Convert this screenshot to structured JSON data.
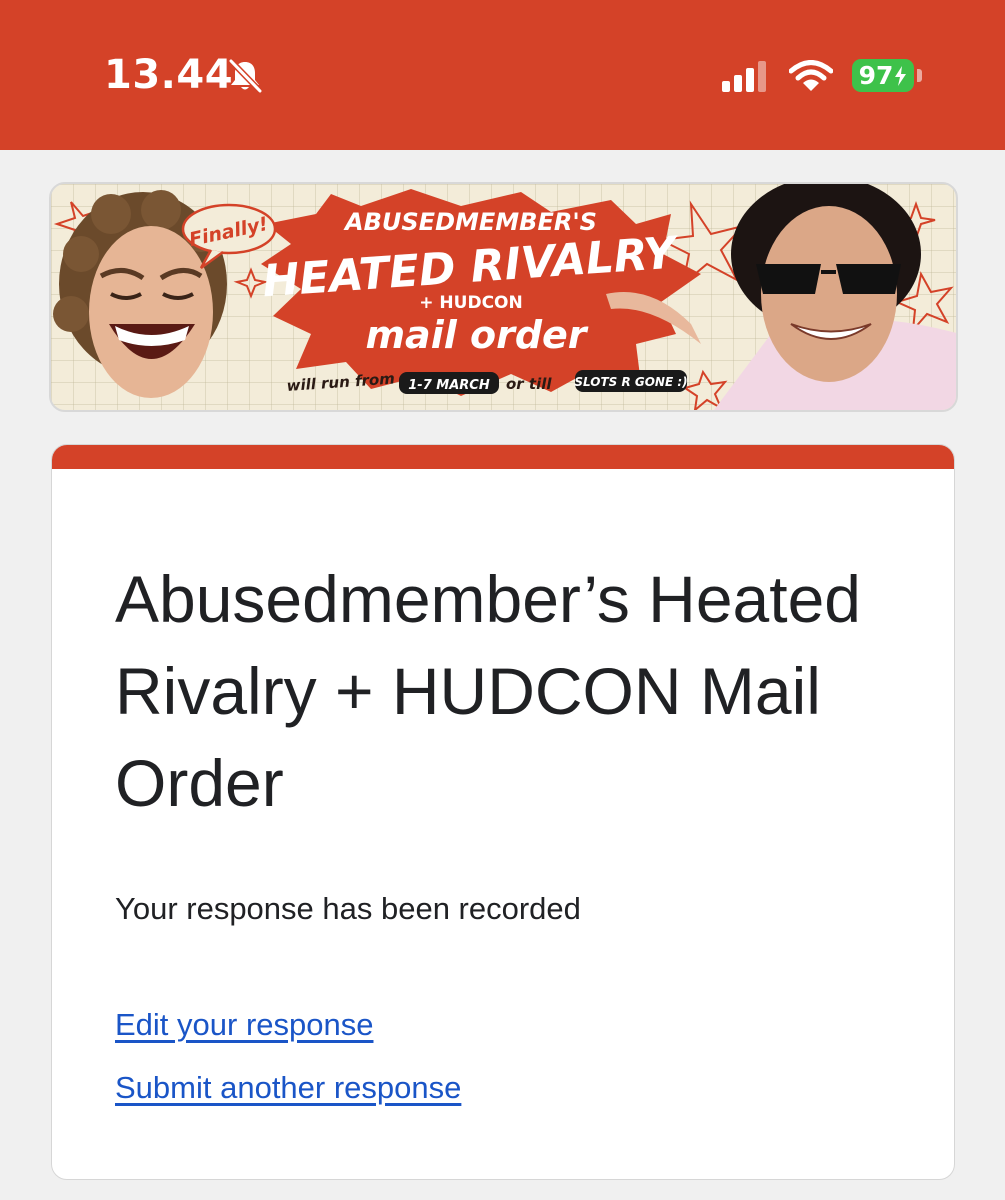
{
  "status_bar": {
    "time": "13.44",
    "battery_percent": "97",
    "icons": [
      "bell-slash-icon",
      "cellular-signal-icon",
      "wifi-icon",
      "battery-charging-icon"
    ],
    "background_color": "#d44228",
    "battery_color": "#3ec24a"
  },
  "banner": {
    "finally_text": "Finally!",
    "line1": "ABUSEDMEMBER'S",
    "line2": "HEATED RIVALRY",
    "line3": "+ HUDCON",
    "line4": "mail order",
    "footer_prefix": "will run from",
    "footer_dates": "1-7 MARCH",
    "footer_middle": "or till",
    "footer_suffix": "SLOTS R GONE :)",
    "accent_color": "#d44228",
    "background_color": "#f3ecd9"
  },
  "form": {
    "title": "Abusedmember’s Heated Rivalry + HUDCON Mail Order",
    "confirmation": "Your response has been recorded",
    "edit_link": "Edit your response",
    "submit_another_link": "Submit another response",
    "accent_color": "#d44228",
    "link_color": "#1a55c7"
  }
}
